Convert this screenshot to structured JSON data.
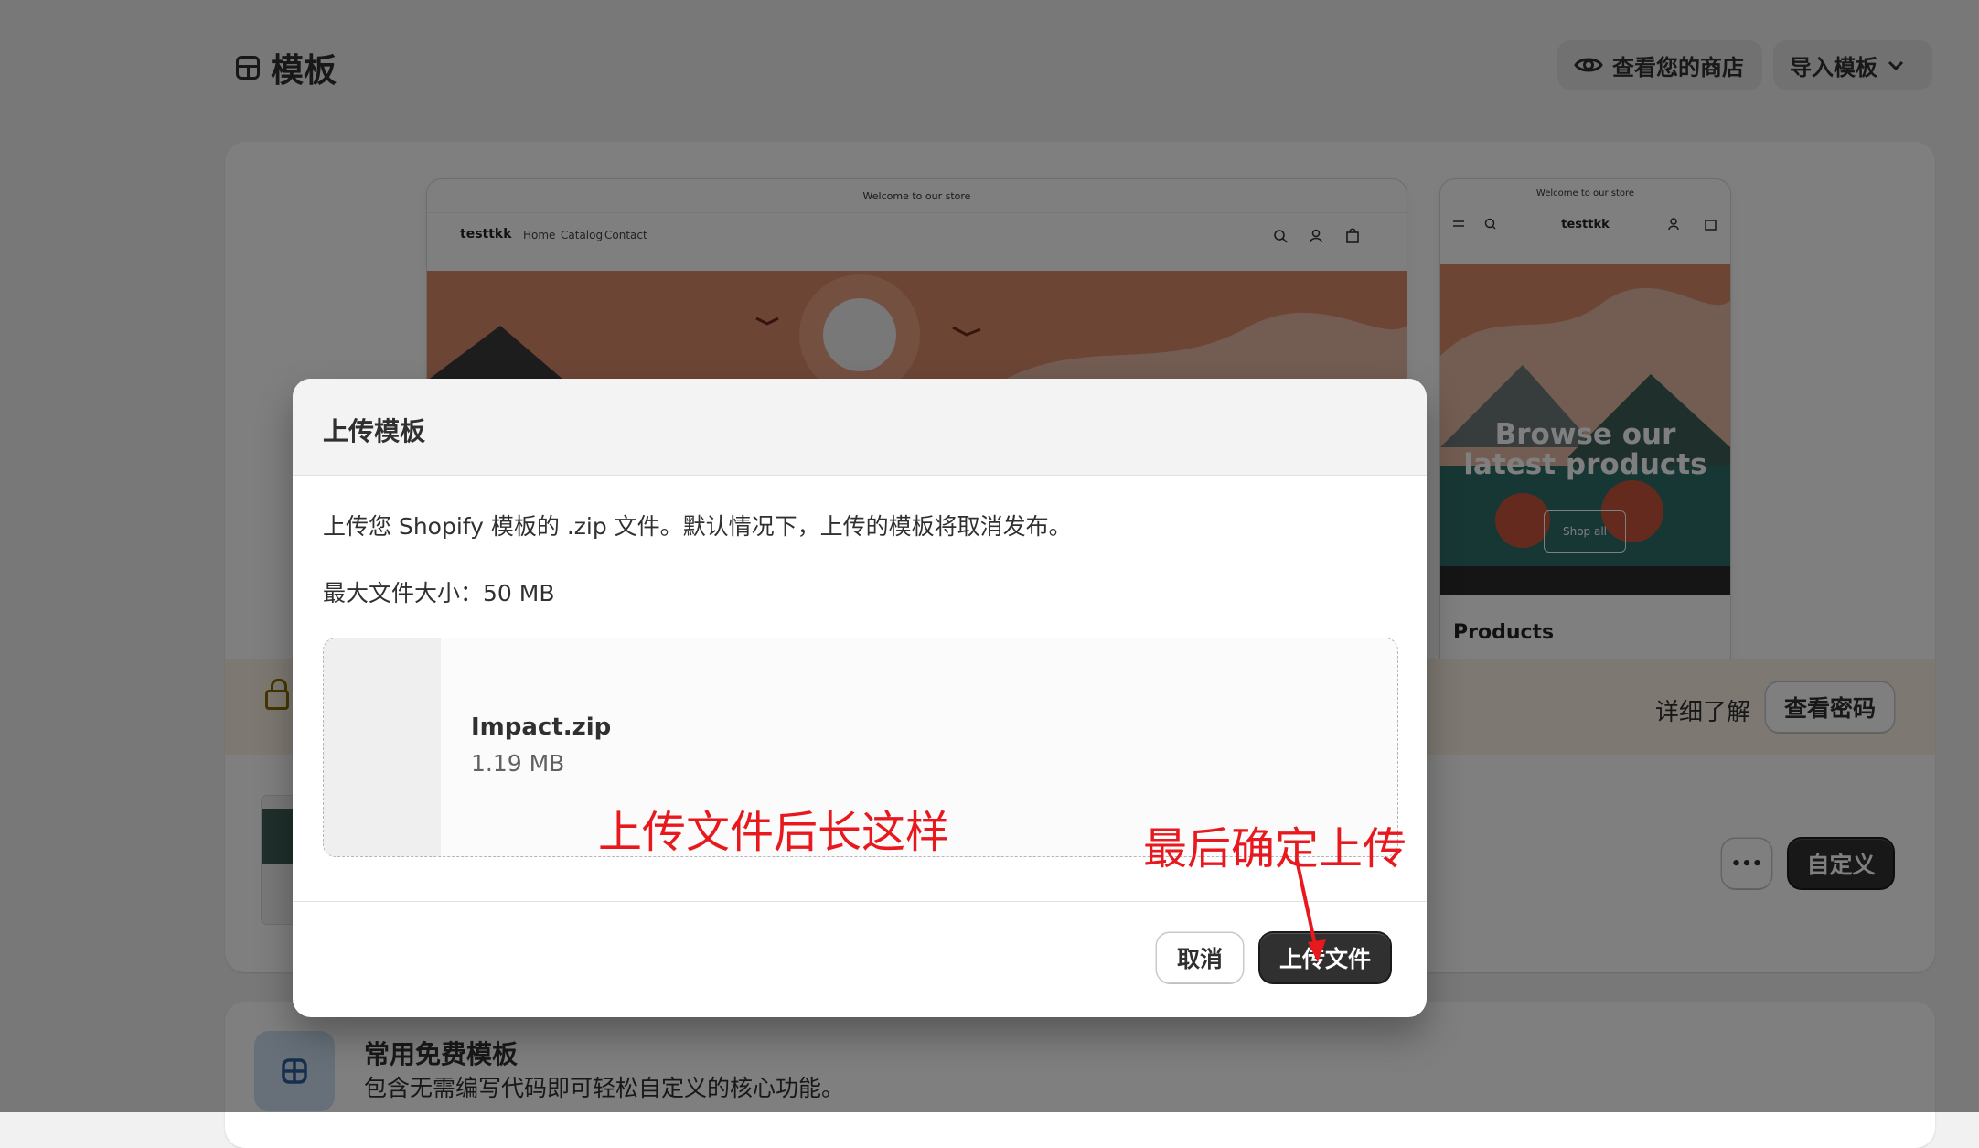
{
  "page": {
    "title": "模板",
    "view_store_label": "查看您的商店",
    "import_label": "导入模板"
  },
  "preview": {
    "announcement": "Welcome to our store",
    "store_name": "testtkk",
    "nav": [
      "Home",
      "Catalog",
      "Contact"
    ],
    "mobile_hero_line1": "Browse our",
    "mobile_hero_line2": "latest products",
    "mobile_button": "Shop all",
    "mobile_section": "Products"
  },
  "banner": {
    "learn_more": "详细了解",
    "view_password": "查看密码"
  },
  "current_theme": {
    "more_label": "•••",
    "customize_label": "自定义"
  },
  "free_themes": {
    "title": "常用免费模板",
    "subtitle": "包含无需编写代码即可轻松自定义的核心功能。"
  },
  "modal": {
    "title": "上传模板",
    "description": "上传您 Shopify 模板的 .zip 文件。默认情况下，上传的模板将取消发布。",
    "max_size": "最大文件大小：50 MB",
    "file_name": "Impact.zip",
    "file_size": "1.19 MB",
    "cancel_label": "取消",
    "upload_label": "上传文件"
  },
  "annotations": {
    "note1": "上传文件后长这样",
    "note2": "最后确定上传"
  },
  "colors": {
    "annotation": "#e8191e",
    "primary_button": "#303030",
    "banner_bg": "#fbf1e3"
  }
}
